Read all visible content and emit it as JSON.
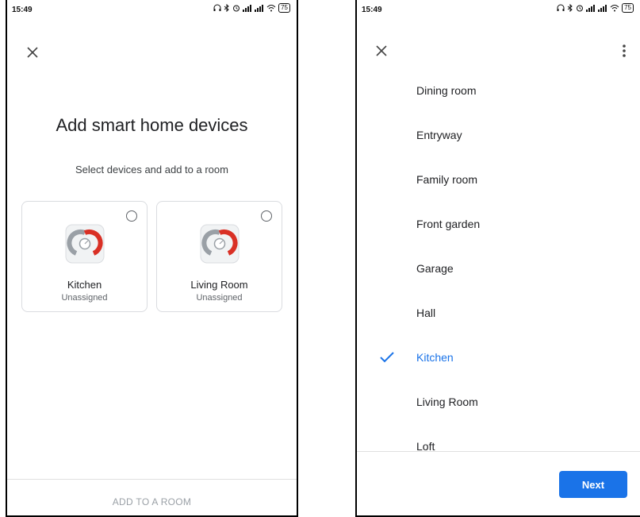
{
  "left_screen": {
    "status": {
      "time": "15:49",
      "battery": "75"
    },
    "title": "Add smart home devices",
    "subtitle": "Select devices and add to a room",
    "devices": [
      {
        "name": "Kitchen",
        "status": "Unassigned",
        "selected": false,
        "icon": "thermostat-icon"
      },
      {
        "name": "Living Room",
        "status": "Unassigned",
        "selected": false,
        "icon": "thermostat-icon"
      }
    ],
    "bottom_action": "ADD TO A ROOM"
  },
  "right_screen": {
    "status": {
      "time": "15:49",
      "battery": "75"
    },
    "rooms": [
      "Dining room",
      "Entryway",
      "Family room",
      "Front garden",
      "Garage",
      "Hall",
      "Kitchen",
      "Living Room",
      "Loft"
    ],
    "selected_room": "Kitchen",
    "next_label": "Next"
  },
  "colors": {
    "accent": "#1a73e8",
    "thermostat_red": "#d93025",
    "thermostat_gray": "#9aa0a6"
  },
  "icons": [
    "close-icon",
    "more-vert-icon",
    "check-icon",
    "radio-unchecked-icon",
    "thermostat-icon"
  ]
}
